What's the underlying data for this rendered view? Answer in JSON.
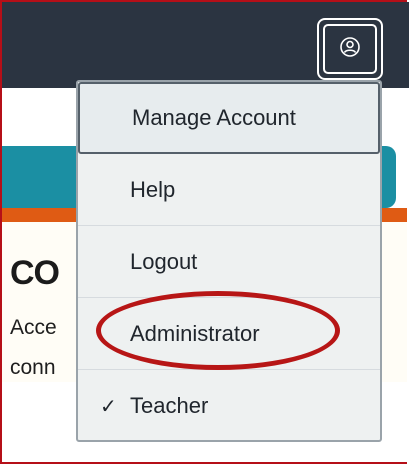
{
  "header": {
    "profile_icon": "user-circle-icon"
  },
  "card": {
    "title": "CO",
    "line1": "Acce",
    "line2": "conn"
  },
  "menu": {
    "items": [
      {
        "label": "Manage Account"
      },
      {
        "label": "Help"
      },
      {
        "label": "Logout"
      },
      {
        "label": "Administrator"
      },
      {
        "label": "Teacher",
        "checked": true
      }
    ],
    "check_icon": "checkmark-icon"
  },
  "colors": {
    "topbar": "#2b3441",
    "teal": "#1b8fa3",
    "orange": "#df5b14",
    "highlight_circle": "#b71616",
    "frame": "#b50f18"
  }
}
